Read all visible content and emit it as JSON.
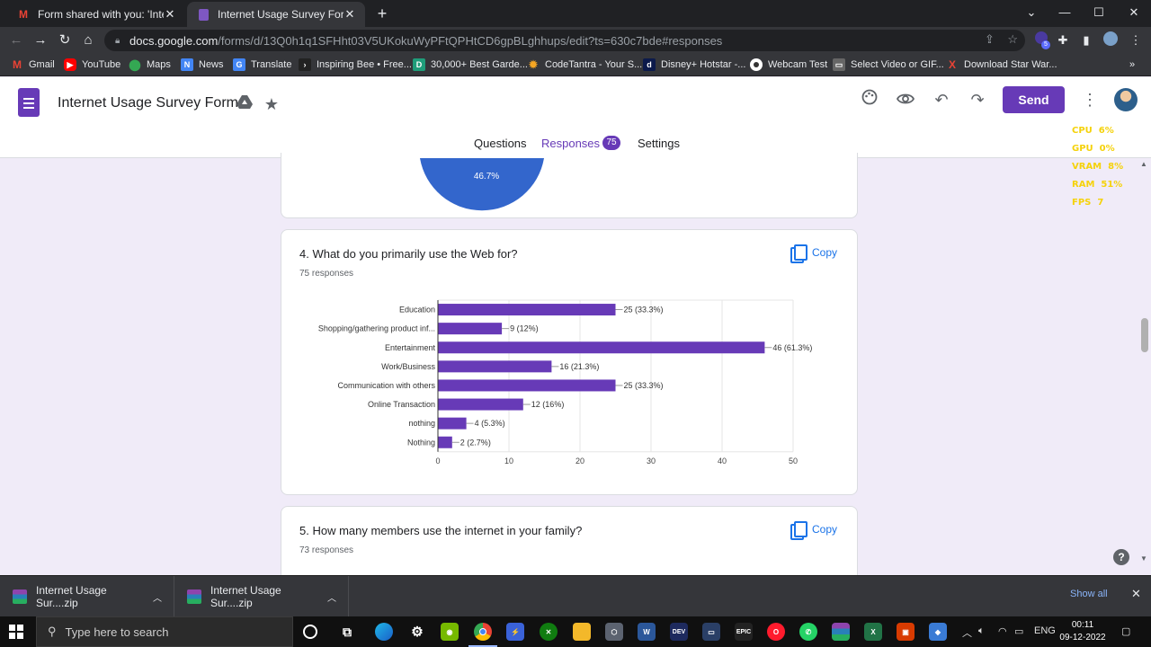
{
  "browser": {
    "tabs": [
      {
        "title": "Form shared with you: 'Internet U",
        "icon": "gmail-icon"
      },
      {
        "title": "Internet Usage Survey Form - Go",
        "icon": "forms-icon"
      }
    ],
    "url_host": "docs.google.com",
    "url_path": "/forms/d/13Q0h1q1SFHht03V5UKokuWyPFtQPHtCD6gpBLghhups/edit?ts=630c7bde#responses",
    "extension_badge": "5",
    "bookmarks": [
      "Gmail",
      "YouTube",
      "Maps",
      "News",
      "Translate",
      "Inspiring Bee • Free...",
      "30,000+ Best Garde...",
      "CodeTantra - Your S...",
      "Disney+ Hotstar -...",
      "Webcam Test",
      "Select Video or GIF...",
      "Download Star War..."
    ]
  },
  "form": {
    "title": "Internet Usage Survey Form",
    "send_label": "Send",
    "tabs": {
      "questions": "Questions",
      "responses": "Responses",
      "settings": "Settings"
    },
    "response_count": "75"
  },
  "overlay": [
    {
      "label": "CPU",
      "value": "6%"
    },
    {
      "label": "GPU",
      "value": "0%"
    },
    {
      "label": "VRAM",
      "value": "8%"
    },
    {
      "label": "RAM",
      "value": "51%"
    },
    {
      "label": "FPS",
      "value": "7"
    }
  ],
  "previous_chart": {
    "visible_slice_label": "46.7%",
    "color": "#3366cc"
  },
  "q4": {
    "question": "4. What do you primarily use the Web for?",
    "responses": "75 responses",
    "copy_label": "Copy"
  },
  "q5": {
    "question": "5. How many members use the internet in your family?",
    "responses": "73 responses",
    "copy_label": "Copy"
  },
  "chart_data": {
    "type": "bar",
    "orientation": "horizontal",
    "categories": [
      "Education",
      "Shopping/gathering product inf...",
      "Entertainment",
      "Work/Business",
      "Communication with others",
      "Online Transaction",
      "nothing",
      "Nothing"
    ],
    "values": [
      25,
      9,
      46,
      16,
      25,
      12,
      4,
      2
    ],
    "labels": [
      "25 (33.3%)",
      "9 (12%)",
      "46 (61.3%)",
      "16 (21.3%)",
      "25 (33.3%)",
      "12 (16%)",
      "4 (5.3%)",
      "2 (2.7%)"
    ],
    "xlim": [
      0,
      50
    ],
    "xticks": [
      "0",
      "10",
      "20",
      "30",
      "40",
      "50"
    ],
    "bar_color": "#673ab7",
    "grid": true
  },
  "downloads": [
    {
      "name": "Internet Usage Sur....zip"
    },
    {
      "name": "Internet Usage Sur....zip"
    }
  ],
  "downloads_show_all": "Show all",
  "taskbar": {
    "search_placeholder": "Type here to search",
    "language": "ENG",
    "time": "00:11",
    "date": "09-12-2022"
  }
}
